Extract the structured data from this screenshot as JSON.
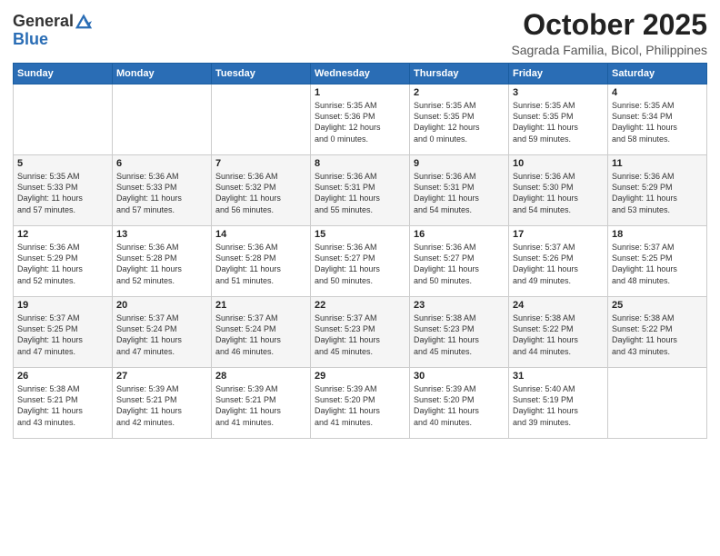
{
  "header": {
    "logo_line1": "General",
    "logo_line2": "Blue",
    "month_title": "October 2025",
    "subtitle": "Sagrada Familia, Bicol, Philippines"
  },
  "days_of_week": [
    "Sunday",
    "Monday",
    "Tuesday",
    "Wednesday",
    "Thursday",
    "Friday",
    "Saturday"
  ],
  "weeks": [
    [
      {
        "day": "",
        "info": ""
      },
      {
        "day": "",
        "info": ""
      },
      {
        "day": "",
        "info": ""
      },
      {
        "day": "1",
        "info": "Sunrise: 5:35 AM\nSunset: 5:36 PM\nDaylight: 12 hours\nand 0 minutes."
      },
      {
        "day": "2",
        "info": "Sunrise: 5:35 AM\nSunset: 5:35 PM\nDaylight: 12 hours\nand 0 minutes."
      },
      {
        "day": "3",
        "info": "Sunrise: 5:35 AM\nSunset: 5:35 PM\nDaylight: 11 hours\nand 59 minutes."
      },
      {
        "day": "4",
        "info": "Sunrise: 5:35 AM\nSunset: 5:34 PM\nDaylight: 11 hours\nand 58 minutes."
      }
    ],
    [
      {
        "day": "5",
        "info": "Sunrise: 5:35 AM\nSunset: 5:33 PM\nDaylight: 11 hours\nand 57 minutes."
      },
      {
        "day": "6",
        "info": "Sunrise: 5:36 AM\nSunset: 5:33 PM\nDaylight: 11 hours\nand 57 minutes."
      },
      {
        "day": "7",
        "info": "Sunrise: 5:36 AM\nSunset: 5:32 PM\nDaylight: 11 hours\nand 56 minutes."
      },
      {
        "day": "8",
        "info": "Sunrise: 5:36 AM\nSunset: 5:31 PM\nDaylight: 11 hours\nand 55 minutes."
      },
      {
        "day": "9",
        "info": "Sunrise: 5:36 AM\nSunset: 5:31 PM\nDaylight: 11 hours\nand 54 minutes."
      },
      {
        "day": "10",
        "info": "Sunrise: 5:36 AM\nSunset: 5:30 PM\nDaylight: 11 hours\nand 54 minutes."
      },
      {
        "day": "11",
        "info": "Sunrise: 5:36 AM\nSunset: 5:29 PM\nDaylight: 11 hours\nand 53 minutes."
      }
    ],
    [
      {
        "day": "12",
        "info": "Sunrise: 5:36 AM\nSunset: 5:29 PM\nDaylight: 11 hours\nand 52 minutes."
      },
      {
        "day": "13",
        "info": "Sunrise: 5:36 AM\nSunset: 5:28 PM\nDaylight: 11 hours\nand 52 minutes."
      },
      {
        "day": "14",
        "info": "Sunrise: 5:36 AM\nSunset: 5:28 PM\nDaylight: 11 hours\nand 51 minutes."
      },
      {
        "day": "15",
        "info": "Sunrise: 5:36 AM\nSunset: 5:27 PM\nDaylight: 11 hours\nand 50 minutes."
      },
      {
        "day": "16",
        "info": "Sunrise: 5:36 AM\nSunset: 5:27 PM\nDaylight: 11 hours\nand 50 minutes."
      },
      {
        "day": "17",
        "info": "Sunrise: 5:37 AM\nSunset: 5:26 PM\nDaylight: 11 hours\nand 49 minutes."
      },
      {
        "day": "18",
        "info": "Sunrise: 5:37 AM\nSunset: 5:25 PM\nDaylight: 11 hours\nand 48 minutes."
      }
    ],
    [
      {
        "day": "19",
        "info": "Sunrise: 5:37 AM\nSunset: 5:25 PM\nDaylight: 11 hours\nand 47 minutes."
      },
      {
        "day": "20",
        "info": "Sunrise: 5:37 AM\nSunset: 5:24 PM\nDaylight: 11 hours\nand 47 minutes."
      },
      {
        "day": "21",
        "info": "Sunrise: 5:37 AM\nSunset: 5:24 PM\nDaylight: 11 hours\nand 46 minutes."
      },
      {
        "day": "22",
        "info": "Sunrise: 5:37 AM\nSunset: 5:23 PM\nDaylight: 11 hours\nand 45 minutes."
      },
      {
        "day": "23",
        "info": "Sunrise: 5:38 AM\nSunset: 5:23 PM\nDaylight: 11 hours\nand 45 minutes."
      },
      {
        "day": "24",
        "info": "Sunrise: 5:38 AM\nSunset: 5:22 PM\nDaylight: 11 hours\nand 44 minutes."
      },
      {
        "day": "25",
        "info": "Sunrise: 5:38 AM\nSunset: 5:22 PM\nDaylight: 11 hours\nand 43 minutes."
      }
    ],
    [
      {
        "day": "26",
        "info": "Sunrise: 5:38 AM\nSunset: 5:21 PM\nDaylight: 11 hours\nand 43 minutes."
      },
      {
        "day": "27",
        "info": "Sunrise: 5:39 AM\nSunset: 5:21 PM\nDaylight: 11 hours\nand 42 minutes."
      },
      {
        "day": "28",
        "info": "Sunrise: 5:39 AM\nSunset: 5:21 PM\nDaylight: 11 hours\nand 41 minutes."
      },
      {
        "day": "29",
        "info": "Sunrise: 5:39 AM\nSunset: 5:20 PM\nDaylight: 11 hours\nand 41 minutes."
      },
      {
        "day": "30",
        "info": "Sunrise: 5:39 AM\nSunset: 5:20 PM\nDaylight: 11 hours\nand 40 minutes."
      },
      {
        "day": "31",
        "info": "Sunrise: 5:40 AM\nSunset: 5:19 PM\nDaylight: 11 hours\nand 39 minutes."
      },
      {
        "day": "",
        "info": ""
      }
    ]
  ]
}
